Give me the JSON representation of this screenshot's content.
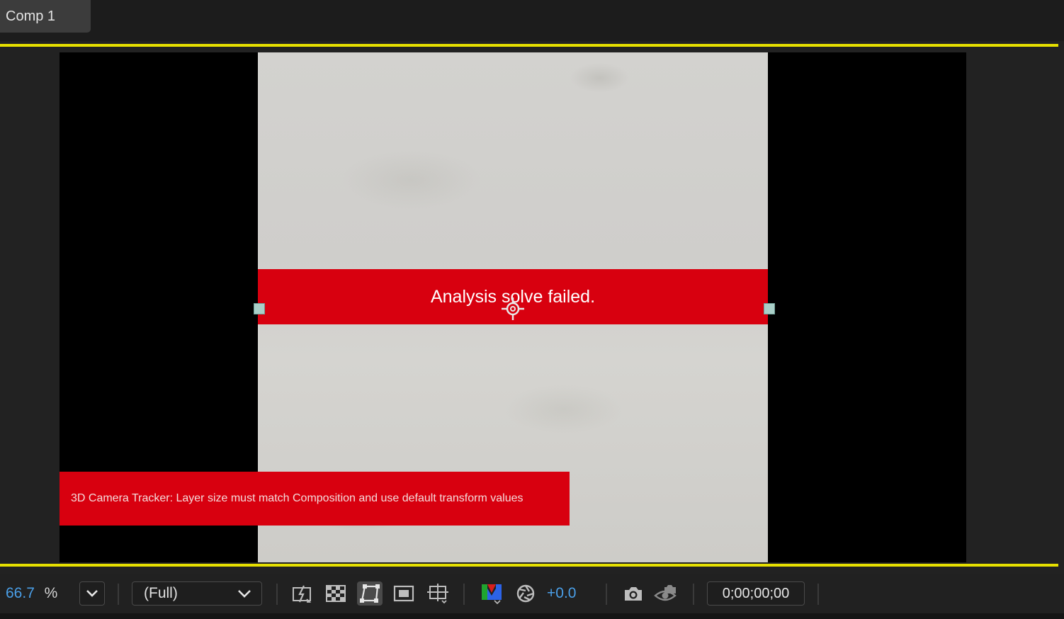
{
  "tab": {
    "label": "Comp 1"
  },
  "viewer": {
    "solve_message": "Analysis solve failed.",
    "tracker_warning": "3D Camera Tracker: Layer size must match Composition and use default transform values"
  },
  "toolbar": {
    "zoom_value": "66.7",
    "zoom_unit": "%",
    "resolution": "(Full)",
    "exposure": "+0.0",
    "timecode": "0;00;00;00"
  },
  "colors": {
    "accent": "#4a9fe8",
    "guide": "#e6e000",
    "error_banner": "#d8000f"
  },
  "icons": [
    "chevron-down-icon",
    "fast-preview-icon",
    "transparency-grid-icon",
    "mask-path-icon",
    "region-of-interest-icon",
    "guides-grid-icon",
    "rgb-channel-icon",
    "exposure-reset-icon",
    "snapshot-icon",
    "show-snapshot-icon"
  ]
}
